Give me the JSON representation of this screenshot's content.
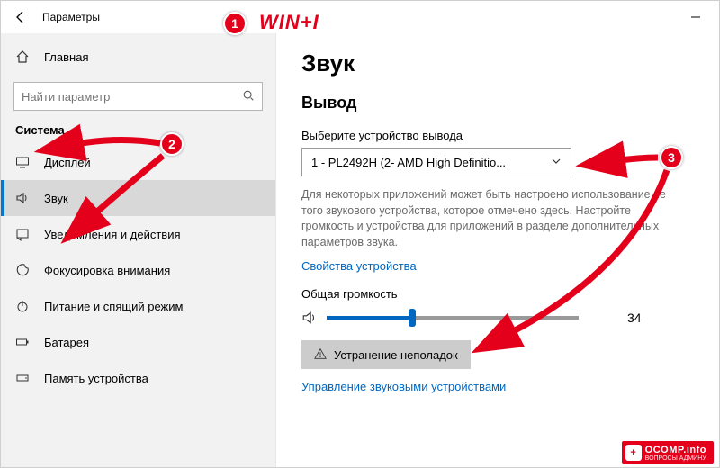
{
  "window": {
    "title": "Параметры"
  },
  "sidebar": {
    "home_label": "Главная",
    "search_placeholder": "Найти параметр",
    "group_label": "Система",
    "items": [
      {
        "label": "Дисплей"
      },
      {
        "label": "Звук"
      },
      {
        "label": "Уведомления и действия"
      },
      {
        "label": "Фокусировка внимания"
      },
      {
        "label": "Питание и спящий режим"
      },
      {
        "label": "Батарея"
      },
      {
        "label": "Память устройства"
      }
    ]
  },
  "main": {
    "heading": "Звук",
    "output_heading": "Вывод",
    "output_device_label": "Выберите устройство вывода",
    "output_device_selected": "1 - PL2492H (2- AMD High Definitio...",
    "output_help": "Для некоторых приложений может быть настроено использование не того звукового устройства, которое отмечено здесь. Настройте громкость и устройства для приложений в разделе дополнительных параметров звука.",
    "device_props_link": "Свойства устройства",
    "master_volume_label": "Общая громкость",
    "volume_value": "34",
    "volume_percent": 34,
    "troubleshoot_label": "Устранение неполадок",
    "manage_devices_link": "Управление звуковыми устройствами"
  },
  "annotations": {
    "hotkey": "WIN+I",
    "badge1": "1",
    "badge2": "2",
    "badge3": "3"
  },
  "watermark": {
    "title": "OCOMP.info",
    "subtitle": "ВОПРОСЫ АДМИНУ"
  }
}
